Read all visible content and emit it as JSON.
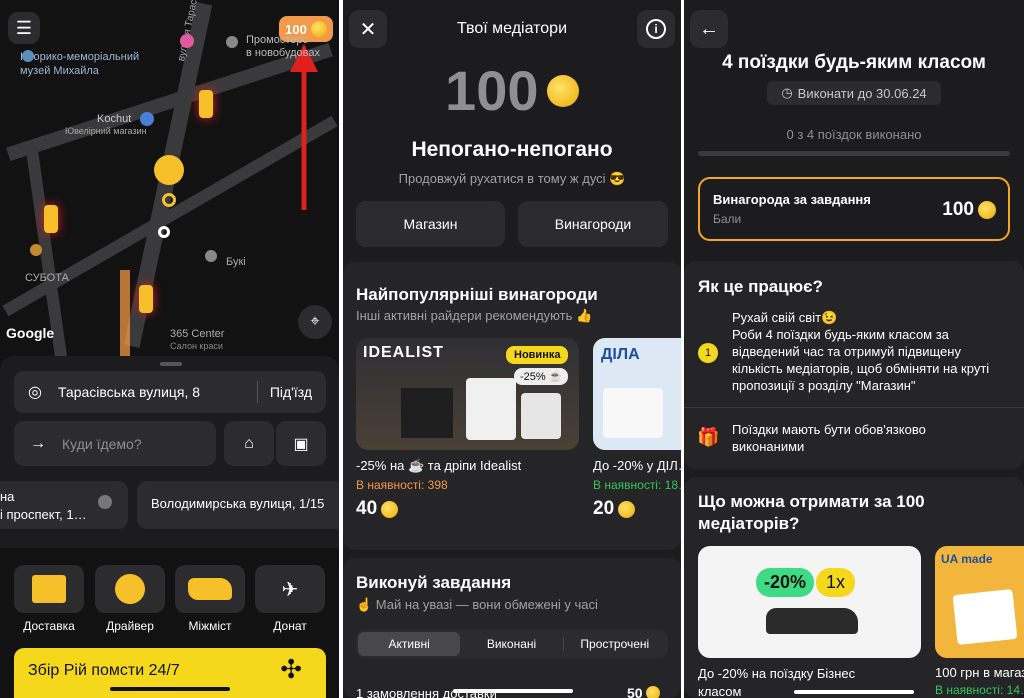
{
  "colors": {
    "accent": "#f5c02a",
    "panel_bg": "#1c1c1e",
    "map_bg": "#121212",
    "orange_badge": "#f2994a",
    "available_orange": "#f2994a",
    "available_green": "#34c759",
    "red_arrow": "#e0201c"
  },
  "p1": {
    "coins": "100",
    "pois": [
      {
        "label": "Історико-меморіальний музей Михайла"
      },
      {
        "label": "Промостерс\nв новобудовах"
      },
      {
        "label": "Kochut"
      },
      {
        "label": "Ювелірний магазин"
      },
      {
        "label": "СУБОТА"
      },
      {
        "label": "Букі"
      },
      {
        "label": "365 Center"
      },
      {
        "label": "Салон краси"
      }
    ],
    "street_label": "вулиця Тарасівська",
    "google": "Google",
    "from_address": "Тарасівська вулиця, 8",
    "entrance": "Під'їзд",
    "to_placeholder": "Куди їдемо?",
    "recent": [
      {
        "line1": "на",
        "line2": "і проспект, 1…"
      },
      {
        "line1": "Володимирська вулиця, 1/15",
        "line2": ""
      }
    ],
    "services": [
      {
        "label": "Доставка",
        "icon": "box-icon"
      },
      {
        "label": "Драйвер",
        "icon": "driver-icon"
      },
      {
        "label": "Міжміст",
        "icon": "ukraine-map-icon"
      },
      {
        "label": "Донат",
        "icon": "drone-icon"
      }
    ],
    "banner": "Збір Рій помсти 24/7"
  },
  "p2": {
    "title": "Твої медіатори",
    "balance": "100",
    "heading": "Непогано-непогано",
    "sub": "Продовжуй рухатися в тому ж дусі 😎",
    "shop_btn": "Магазин",
    "rewards_btn": "Винагороди",
    "popular_title": "Найпопулярніші винагороди",
    "popular_sub": "Інші активні райдери рекомендують 👍",
    "rewards": [
      {
        "title": "-25% на ☕ та дріпи Idealist",
        "avail": "В наявності: 398",
        "price": "40",
        "badge": "Новинка",
        "discount": "-25% ☕",
        "brand": "IDEALIST"
      },
      {
        "title": "До -20% у ДІЛ…",
        "avail": "В наявності: 18…",
        "price": "20",
        "brand": "ДІЛА"
      }
    ],
    "tasks_title": "Виконуй завдання",
    "tasks_sub": "☝️ Май на увазі — вони обмежені у часі",
    "tabs": [
      "Активні",
      "Виконані",
      "Прострочені"
    ],
    "task_row": "1 замовлення доставки",
    "task_price": "50"
  },
  "p3": {
    "title": "4 поїздки будь-яким класом",
    "deadline": "Виконати до 30.06.24",
    "progress_text": "0 з 4 поїздок виконано",
    "progress": 0,
    "reward_title": "Винагорода за завдання",
    "reward_sub": "Бали",
    "reward_value": "100",
    "how_title": "Як це працює?",
    "how_step_num": "1",
    "how_step_text": "Рухай свій світ😉\nРоби 4 поїздки будь-яким класом за відведений час та отримуй підвищену кількість медіаторів, щоб обміняти на круті пропозиції з розділу \"Магазин\"",
    "how_note": "Поїздки мають бути обов'язково виконаними",
    "what_title": "Що можна отримати за 100 медіаторів?",
    "offers": [
      {
        "title": "До -20% на поїздку Бізнес класом",
        "discount": "-20%",
        "mult": "1x"
      },
      {
        "title": "100 грн в магаз…",
        "avail": "В наявності: 14…",
        "brand": "UA made"
      }
    ]
  }
}
